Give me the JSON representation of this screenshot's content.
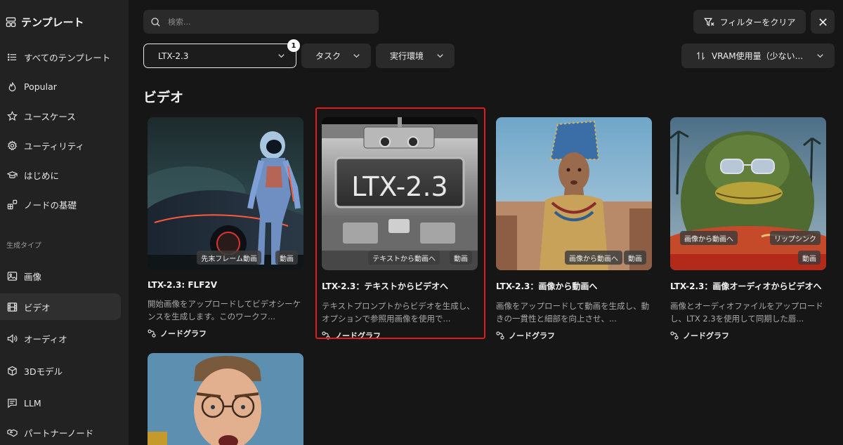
{
  "sidebar": {
    "title": "テンプレート",
    "items": [
      {
        "label": "すべてのテンプレート",
        "icon": "list-icon"
      },
      {
        "label": "Popular",
        "icon": "flame-icon"
      },
      {
        "label": "ユースケース",
        "icon": "star-icon"
      },
      {
        "label": "ユーティリティ",
        "icon": "gear-icon"
      },
      {
        "label": "はじめに",
        "icon": "graduation-cap-icon"
      },
      {
        "label": "ノードの基礎",
        "icon": "blocks-icon"
      }
    ],
    "section_label": "生成タイプ",
    "types": [
      {
        "label": "画像",
        "icon": "image-icon",
        "active": false
      },
      {
        "label": "ビデオ",
        "icon": "film-icon",
        "active": true
      },
      {
        "label": "オーディオ",
        "icon": "speaker-icon",
        "active": false
      },
      {
        "label": "3Dモデル",
        "icon": "cube-icon",
        "active": false
      },
      {
        "label": "LLM",
        "icon": "message-icon",
        "active": false
      },
      {
        "label": "パートナーノード",
        "icon": "handshake-icon",
        "active": false
      }
    ]
  },
  "search": {
    "placeholder": "検索..."
  },
  "toolbar": {
    "clear_filters_label": "フィルターをクリア",
    "close_icon": "close-icon"
  },
  "filters": {
    "model": {
      "value": "LTX-2.3",
      "badge_count": "1"
    },
    "task": {
      "label": "タスク"
    },
    "environment": {
      "label": "実行環境"
    },
    "sort": {
      "label": "VRAM使用量（少ない..."
    }
  },
  "section": {
    "title": "ビデオ"
  },
  "cards": [
    {
      "title": "LTX-2.3: FLF2V",
      "description": "開始画像をアップロードしてビデオシーケンスを生成します。このワークフ...",
      "tags": [
        "先末フレーム動画",
        "動画"
      ],
      "type_label": "ノードグラフ"
    },
    {
      "title": "LTX-2.3：テキストからビデオへ",
      "description": "テキストプロンプトからビデオを生成し、オプションで参照用画像を使用で...",
      "tags": [
        "テキストから動画へ",
        "動画"
      ],
      "type_label": "ノードグラフ",
      "thumb_text": "LTX-2.3",
      "selected": true
    },
    {
      "title": "LTX-2.3：画像から動画へ",
      "description": "画像をアップロードして動画を生成し、動きの一貫性と細部を向上させ、...",
      "tags": [
        "画像から動画へ",
        "動画"
      ],
      "type_label": "ノードグラフ"
    },
    {
      "title": "LTX-2.3：画像オーディオからビデオへ",
      "description": "画像とオーディオファイルをアップロードし、LTX 2.3を使用して同期した唇...",
      "tags": [
        "画像から動画へ",
        "リップシンク",
        "動画"
      ],
      "type_label": "ノードグラフ"
    }
  ],
  "colors": {
    "background": "#161616",
    "sidebar": "#222222",
    "control": "#2a2a2a",
    "selection_outline": "#e01c1c"
  }
}
